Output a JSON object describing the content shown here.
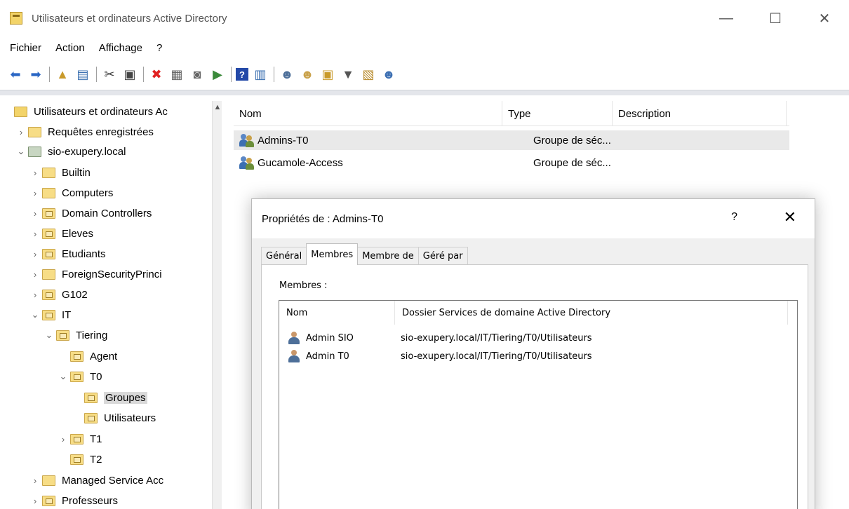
{
  "window": {
    "title": "Utilisateurs et ordinateurs Active Directory",
    "minimize": "—",
    "maximize": "☐",
    "close": "✕"
  },
  "menu": [
    "Fichier",
    "Action",
    "Affichage",
    "?"
  ],
  "toolbar": {
    "icons": [
      "back-arrow-icon",
      "forward-arrow-icon",
      "up-folder-icon",
      "console-tree-icon",
      "cut-icon",
      "paste-icon",
      "delete-icon",
      "properties-icon",
      "refresh-icon",
      "export-list-icon",
      "help-icon",
      "action-pane-icon",
      "new-user-icon",
      "new-group-icon",
      "new-ou-icon",
      "filter-icon",
      "find-icon",
      "add-to-group-icon"
    ]
  },
  "tree": {
    "root": "Utilisateurs et ordinateurs Ac",
    "saved_queries": "Requêtes enregistrées",
    "domain": "sio-exupery.local",
    "items": {
      "builtin": "Builtin",
      "computers": "Computers",
      "domain_controllers": "Domain Controllers",
      "eleves": "Eleves",
      "etudiants": "Etudiants",
      "foreign": "ForeignSecurityPrinci",
      "g102": "G102",
      "it": "IT",
      "tiering": "Tiering",
      "agent": "Agent",
      "t0": "T0",
      "groupes": "Groupes",
      "utilisateurs": "Utilisateurs",
      "t1": "T1",
      "t2": "T2",
      "managed": "Managed Service Acc",
      "professeurs": "Professeurs"
    }
  },
  "list": {
    "columns": {
      "name": "Nom",
      "type": "Type",
      "description": "Description"
    },
    "rows": [
      {
        "name": "Admins-T0",
        "type": "Groupe de séc..."
      },
      {
        "name": "Gucamole-Access",
        "type": "Groupe de séc..."
      }
    ]
  },
  "dialog": {
    "title": "Propriétés de : Admins-T0",
    "help": "?",
    "close": "✕",
    "tabs": [
      "Général",
      "Membres",
      "Membre de",
      "Géré par"
    ],
    "members_label": "Membres :",
    "columns": {
      "name": "Nom",
      "folder": "Dossier Services de domaine Active Directory"
    },
    "members": [
      {
        "name": "Admin SIO",
        "folder": "sio-exupery.local/IT/Tiering/T0/Utilisateurs"
      },
      {
        "name": "Admin T0",
        "folder": "sio-exupery.local/IT/Tiering/T0/Utilisateurs"
      }
    ]
  }
}
